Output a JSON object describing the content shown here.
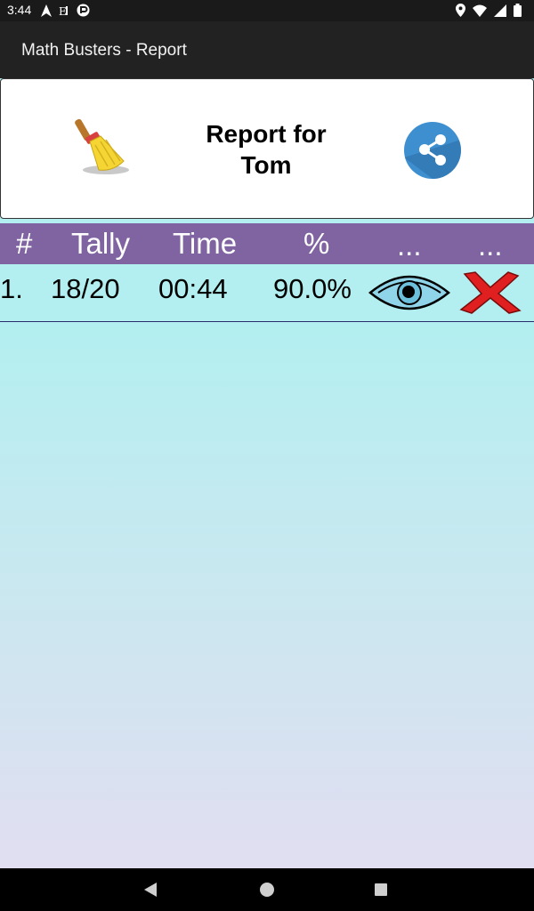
{
  "status_bar": {
    "time": "3:44",
    "left_icons": [
      "navigation-icon",
      "sim-icon",
      "app-notification-icon"
    ],
    "right_icons": [
      "location-icon",
      "wifi-icon",
      "signal-icon",
      "battery-icon"
    ]
  },
  "app_bar": {
    "title": "Math Busters - Report"
  },
  "header": {
    "report_title_line1": "Report for",
    "report_title_line2": "Tom",
    "clear_icon": "broom-icon",
    "share_icon": "share-icon"
  },
  "table": {
    "columns": [
      "#",
      "Tally",
      "Time",
      "%",
      "...",
      "..."
    ],
    "rows": [
      {
        "num": "1.",
        "tally": "18/20",
        "time": "00:44",
        "percent": "90.0%",
        "view_icon": "eye-icon",
        "delete_icon": "close-icon"
      }
    ]
  },
  "colors": {
    "app_bar": "#222222",
    "header_row": "#8064a2",
    "row_bg": "#b3eff0",
    "share_button": "#3e8fd0",
    "delete": "#e02020"
  },
  "nav_bar": {
    "buttons": [
      "back-icon",
      "home-icon",
      "recents-icon"
    ]
  }
}
